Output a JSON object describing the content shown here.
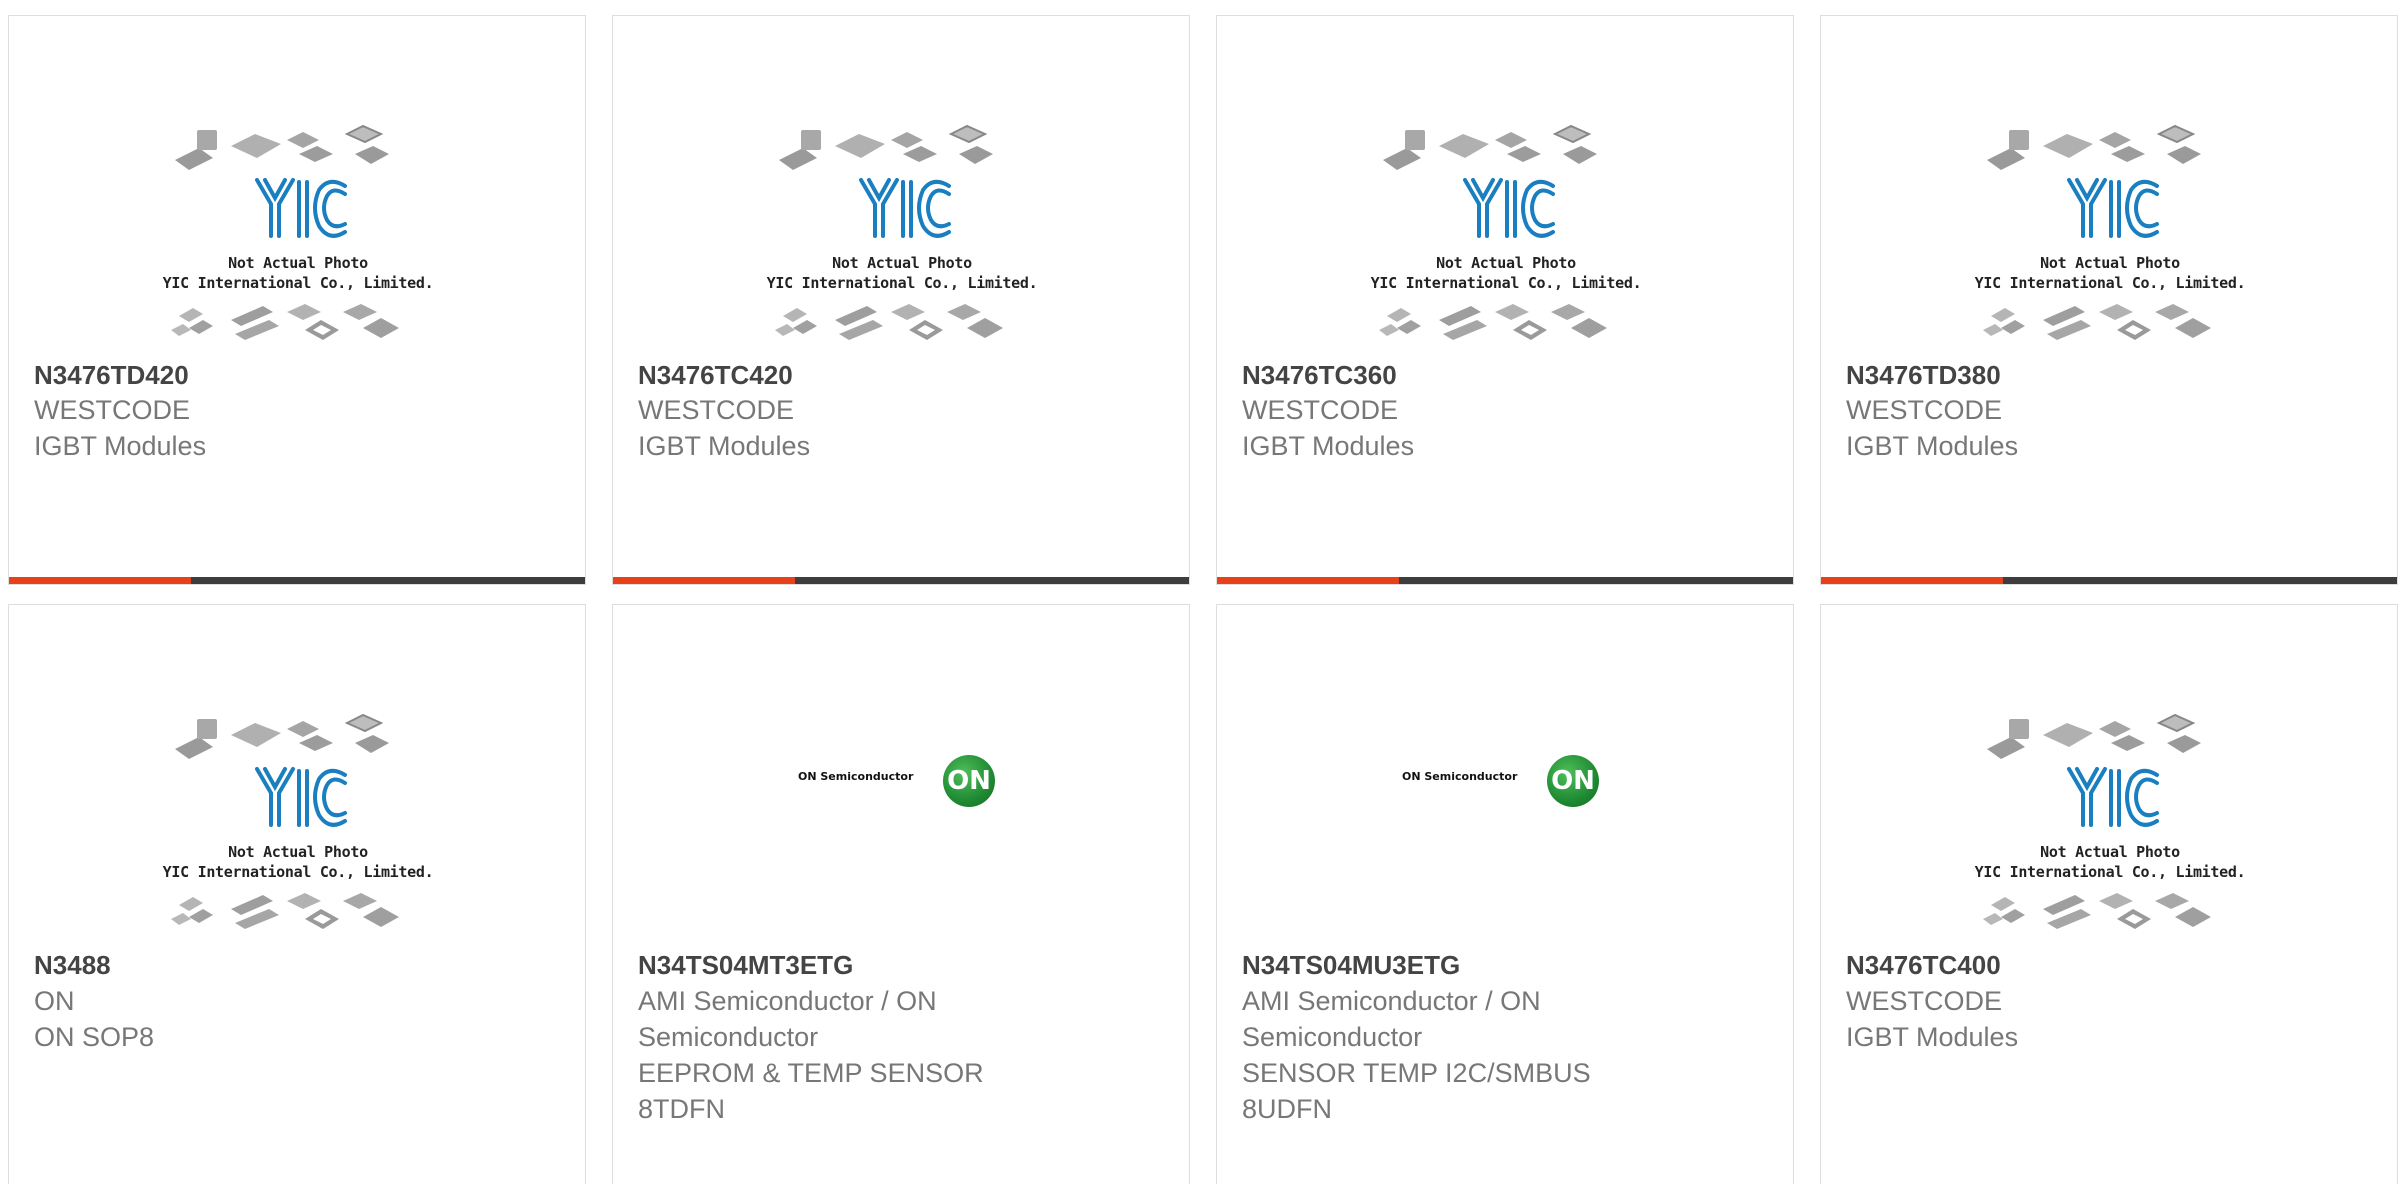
{
  "placeholder": {
    "line1": "Not Actual Photo",
    "line2": "YIC International Co., Limited.",
    "logo_text": "YIC"
  },
  "on_logo": {
    "brand": "ON Semiconductor",
    "mark": "ON"
  },
  "colors": {
    "accent": "#e8411a",
    "bar": "#3d3d3d",
    "title": "#444444",
    "text": "#777777",
    "yic_blue": "#1a7fc0"
  },
  "products": [
    {
      "part": "N3476TD420",
      "lines": [
        "WESTCODE",
        "IGBT Modules"
      ],
      "image": "yic-placeholder"
    },
    {
      "part": "N3476TC420",
      "lines": [
        "WESTCODE",
        "IGBT Modules"
      ],
      "image": "yic-placeholder"
    },
    {
      "part": "N3476TC360",
      "lines": [
        "WESTCODE",
        "IGBT Modules"
      ],
      "image": "yic-placeholder"
    },
    {
      "part": "N3476TD380",
      "lines": [
        "WESTCODE",
        "IGBT Modules"
      ],
      "image": "yic-placeholder"
    },
    {
      "part": "N3488",
      "lines": [
        "ON",
        "ON SOP8"
      ],
      "image": "yic-placeholder"
    },
    {
      "part": "N34TS04MT3ETG",
      "lines": [
        "AMI Semiconductor / ON",
        "Semiconductor",
        "EEPROM & TEMP SENSOR",
        "8TDFN"
      ],
      "image": "on-semiconductor-logo"
    },
    {
      "part": "N34TS04MU3ETG",
      "lines": [
        "AMI Semiconductor / ON",
        "Semiconductor",
        "SENSOR TEMP I2C/SMBUS",
        "8UDFN"
      ],
      "image": "on-semiconductor-logo"
    },
    {
      "part": "N3476TC400",
      "lines": [
        "WESTCODE",
        "IGBT Modules"
      ],
      "image": "yic-placeholder"
    }
  ]
}
